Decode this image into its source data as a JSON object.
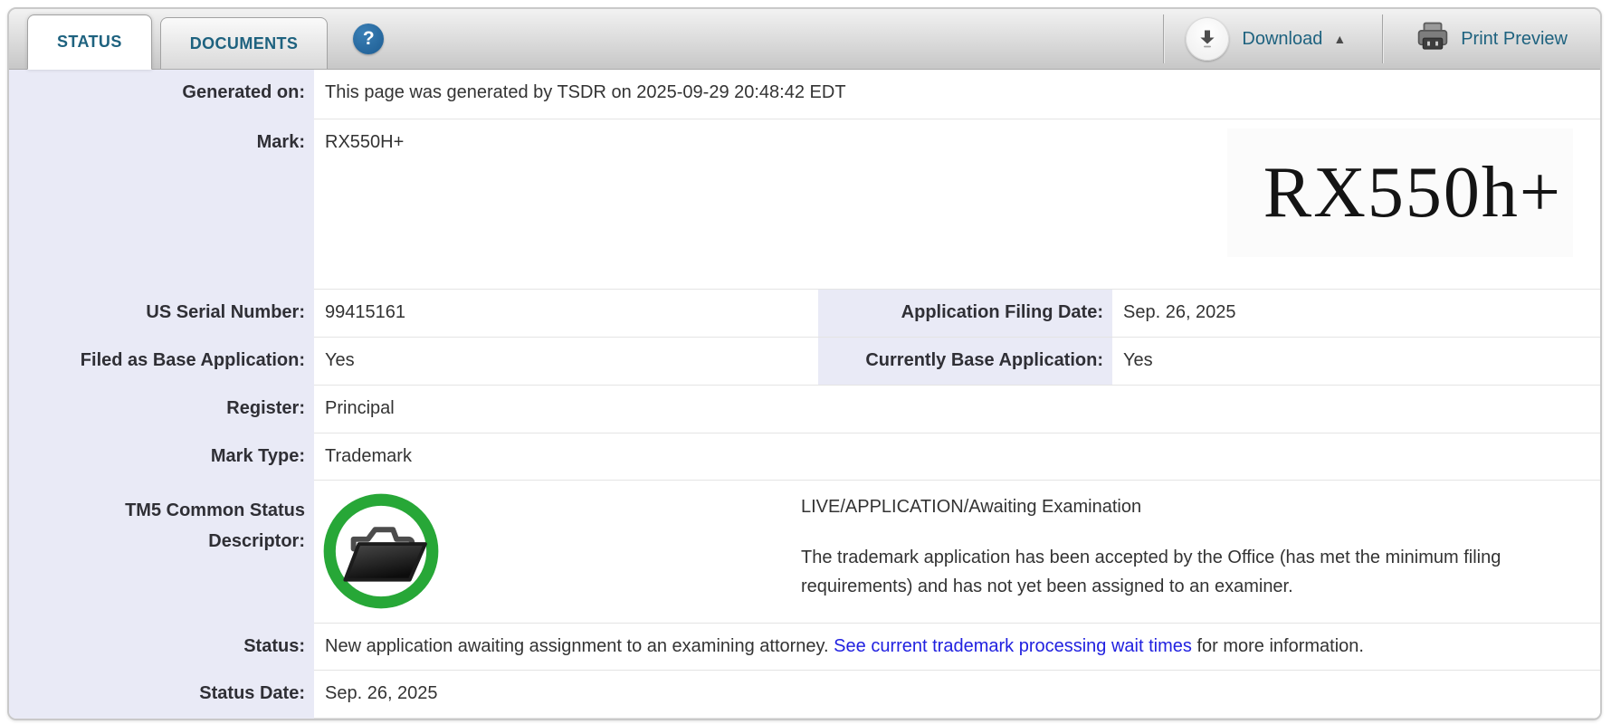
{
  "tabs": [
    {
      "label": "STATUS"
    },
    {
      "label": "DOCUMENTS"
    }
  ],
  "toolbar": {
    "download_label": "Download",
    "print_label": "Print Preview"
  },
  "icons": {
    "help_glyph": "?",
    "collapse_glyph": "▲",
    "help_icon": "question-mark-in-blue-circle",
    "download_icon": "down-arrow-in-white-circle",
    "print_icon": "printer",
    "tm5_icon": "open-folder-in-green-circle"
  },
  "colors": {
    "accent_teal": "#1e627f",
    "link_blue": "#2121e0",
    "label_bg": "#e9eaf6",
    "live_green": "#27a737"
  },
  "rows": {
    "generated": {
      "label": "Generated on:",
      "value": "This page was generated by TSDR on 2025-09-29 20:48:42 EDT"
    },
    "mark": {
      "label": "Mark:",
      "value": "RX550H+"
    },
    "serial": {
      "label": "US Serial Number:",
      "value": "99415161"
    },
    "filing_date": {
      "label": "Application Filing Date:",
      "value": "Sep. 26, 2025"
    },
    "filed_base": {
      "label": "Filed as Base Application:",
      "value": "Yes"
    },
    "currently_base": {
      "label": "Currently Base Application:",
      "value": "Yes"
    },
    "register": {
      "label": "Register:",
      "value": "Principal"
    },
    "mark_type": {
      "label": "Mark Type:",
      "value": "Trademark"
    },
    "tm5": {
      "label_line1": "TM5 Common Status",
      "label_line2": "Descriptor:",
      "status_line": "LIVE/APPLICATION/Awaiting Examination",
      "description": "The trademark application has been accepted by the Office (has met the minimum filing requirements) and has not yet been assigned to an examiner."
    },
    "status": {
      "label": "Status:",
      "text_before": "New application awaiting assignment to an examining attorney. ",
      "link_text": "See current trademark processing wait times",
      "text_after": " for more information."
    },
    "status_date": {
      "label": "Status Date:",
      "value": "Sep. 26, 2025"
    }
  },
  "mark_image": {
    "text": "RX550h+"
  }
}
